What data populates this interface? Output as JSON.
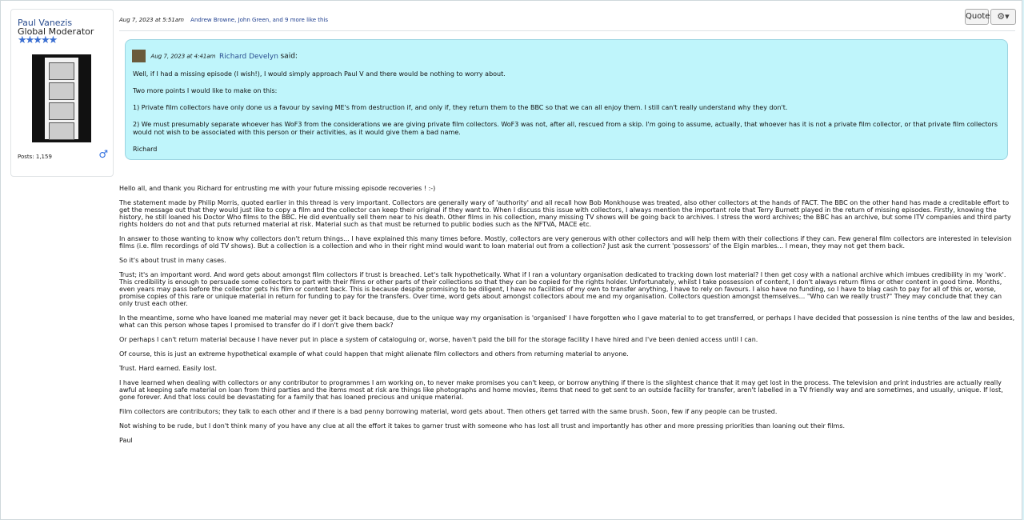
{
  "user": {
    "name": "Paul Vanezis",
    "title": "Global Moderator",
    "stars": "★★★★★",
    "posts": "Posts: 1,159",
    "gender_icon": "male-icon"
  },
  "post": {
    "date": "Aug 7, 2023 at 5:51am",
    "likes": "Andrew Browne, John Green, and 9 more like this",
    "quote_label": "Quote",
    "gear_label": "⚙▾"
  },
  "quote": {
    "date": "Aug 7, 2023 at 4:41am",
    "author": "Richard Develyn",
    "said": "said:",
    "paragraphs": [
      "Well, if I had a missing episode (I wish!), I would simply approach Paul V and there would be nothing to worry about.",
      "Two more points I would like to make on this:",
      "1) Private film collectors have only done us a favour by saving ME's from destruction if, and only if, they return them to the BBC so that we can all enjoy them. I still can't really understand why they don't.",
      "2) We must presumably separate whoever has WoF3 from the considerations we are giving private film collectors. WoF3 was not, after all, rescued from a skip. I'm going to assume, actually, that whoever has it is not a private film collector, or that private film collectors would not wish to be associated with this person or their activities, as it would give them a bad name.",
      "Richard"
    ]
  },
  "body": [
    "Hello all, and thank you Richard for entrusting me with your future missing episode recoveries ! :-)",
    "The statement made by Philip Morris, quoted earlier in this thread is very important. Collectors are generally wary of 'authority' and all recall how Bob Monkhouse was treated, also other collectors at the hands of FACT. The BBC on the other hand has made a creditable effort to get the message out that they would just like to copy a film and the collector can keep their original if they want to. When I discuss this issue with collectors, I always mention the important role that Terry Burnett played in the return of missing episodes. Firstly, knowing the history, he still loaned his Doctor Who films to the BBC. He did eventually sell them near to his death. Other films in his collection, many missing TV shows will be going back to archives. I stress the word archives; the BBC has an archive, but some ITV companies and third party rights holders do not and that puts returned material at risk. Material such as that must be returned to public bodies such as the NFTVA, MACE etc.",
    "In answer to those wanting to know why collectors don't return things... I have explained this many times before. Mostly, collectors are very generous with other collectors and will help them with their collections if they can. Few general film collectors are interested in television films (i.e. film recordings of old TV shows). But a collection is a collection and who in their right mind would want to loan material out from a collection? Just ask the current 'possessors' of the Elgin marbles... I mean, they may not get them back.",
    "So it's about trust in many cases.",
    "Trust; it's an important word. And word gets about amongst film collectors if trust is breached. Let's talk hypothetically. What if I ran a voluntary organisation dedicated to tracking down lost material? I then get cosy with a national archive which imbues credibility in my 'work'. This credibility is enough to persuade some collectors to part with their films or other parts of their collections so that they can be copied for the rights holder. Unfortunately, whilst I take possession of content, I don't always return films or other content in good time. Months, even years may pass before the collector gets his film or content back. This is because despite promising to be diligent, I have no facilities of my own to transfer anything, I have to rely on favours. I also have no funding, so I have to blag cash to pay for all of this or, worse, promise copies of this rare or unique material in return for funding to pay for the transfers. Over time, word gets about amongst collectors about me and my organisation. Collectors question amongst themselves... \"Who can we really trust?\" They may conclude that they can only trust each other.",
    "In the meantime, some who have loaned me material may never get it back because, due to the unique way my organisation is 'organised' I have forgotten who I gave material to to get transferred, or perhaps I have decided that possession is nine tenths of the law and besides, what can this person whose tapes I promised to transfer do if I don't give them back?",
    "Or perhaps I can't return material because I have never put in place a system of cataloguing or, worse, haven't paid the bill for the storage facility I have hired and I've been denied access until I can.",
    "Of course, this is just an extreme hypothetical example of what could happen that might alienate film collectors and others from returning material to anyone.",
    "Trust. Hard earned. Easily lost.",
    "I have learned when dealing with collectors or any contributor to programmes I am working on, to never make promises you can't keep, or borrow anything if there is the slightest chance that it may get lost in the process. The television and print industries are actually really awful at keeping safe material on loan from third parties and the items most at risk are things like photographs and home movies, items that need to get sent to an outside facility for transfer, aren't labelled in a TV friendly way and are sometimes, and usually, unique. If lost, gone forever. And that loss could be devastating for a family that has loaned precious and unique material.",
    "Film collectors are contributors; they talk to each other and if there is a bad penny borrowing material, word gets about. Then others get tarred with the same brush. Soon, few if any people can be trusted.",
    "Not wishing to be rude, but I don't think many of you have any clue at all the effort it takes to garner trust with someone who has lost all trust and importantly has other and more pressing priorities than loaning out their films.",
    "Paul"
  ]
}
